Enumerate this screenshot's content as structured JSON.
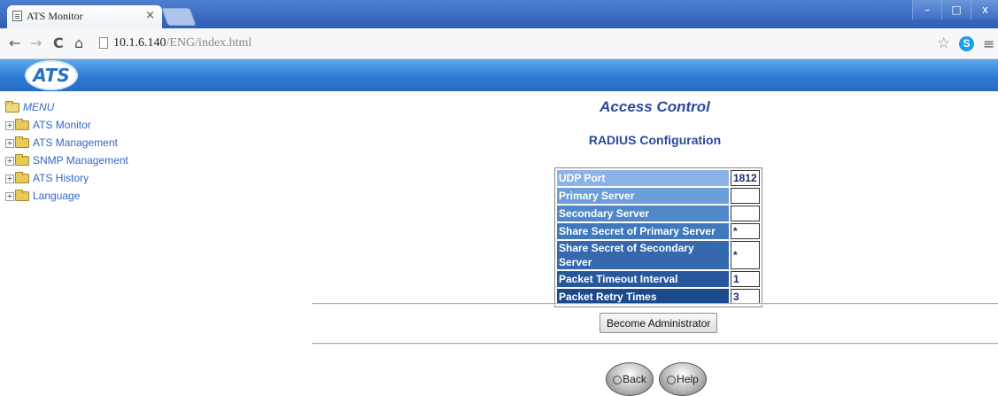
{
  "browser": {
    "tab_title": "ATS Monitor",
    "tab_close": "×",
    "address_host": "10.1.6.140",
    "address_path": "/ENG/index.html",
    "window_controls": {
      "minimize": "–",
      "maximize": "□",
      "close": "x"
    },
    "icons": [
      "back-arrow-icon",
      "forward-arrow-icon",
      "reload-icon",
      "home-icon",
      "page-icon",
      "star-icon",
      "skype-icon",
      "menu-icon"
    ]
  },
  "header": {
    "logo": "ATS",
    "accent": "#2b79d1"
  },
  "menu": {
    "title": "MENU",
    "items": [
      {
        "label": "ATS Monitor"
      },
      {
        "label": "ATS Management"
      },
      {
        "label": "SNMP Management"
      },
      {
        "label": "ATS History"
      },
      {
        "label": "Language"
      }
    ]
  },
  "main": {
    "title": "Access Control",
    "subtitle": "RADIUS Configuration",
    "rows": [
      {
        "label": "UDP Port",
        "value": "1812",
        "color": "#8cb3e6"
      },
      {
        "label": "Primary Server",
        "value": "",
        "color": "#6c9fd8"
      },
      {
        "label": "Secondary Server",
        "value": "",
        "color": "#4f87c9"
      },
      {
        "label": "Share Secret of Primary Server",
        "value": "*",
        "color": "#3f78bd"
      },
      {
        "label": "Share Secret of Secondary Server",
        "value": "*",
        "color": "#3469ad"
      },
      {
        "label": "Packet Timeout Interval",
        "value": "1",
        "color": "#27589c"
      },
      {
        "label": "Packet Retry Times",
        "value": "3",
        "color": "#1b4a8c"
      }
    ],
    "admin_button": "Become Administrator",
    "back_button": "Back",
    "help_button": "Help"
  }
}
